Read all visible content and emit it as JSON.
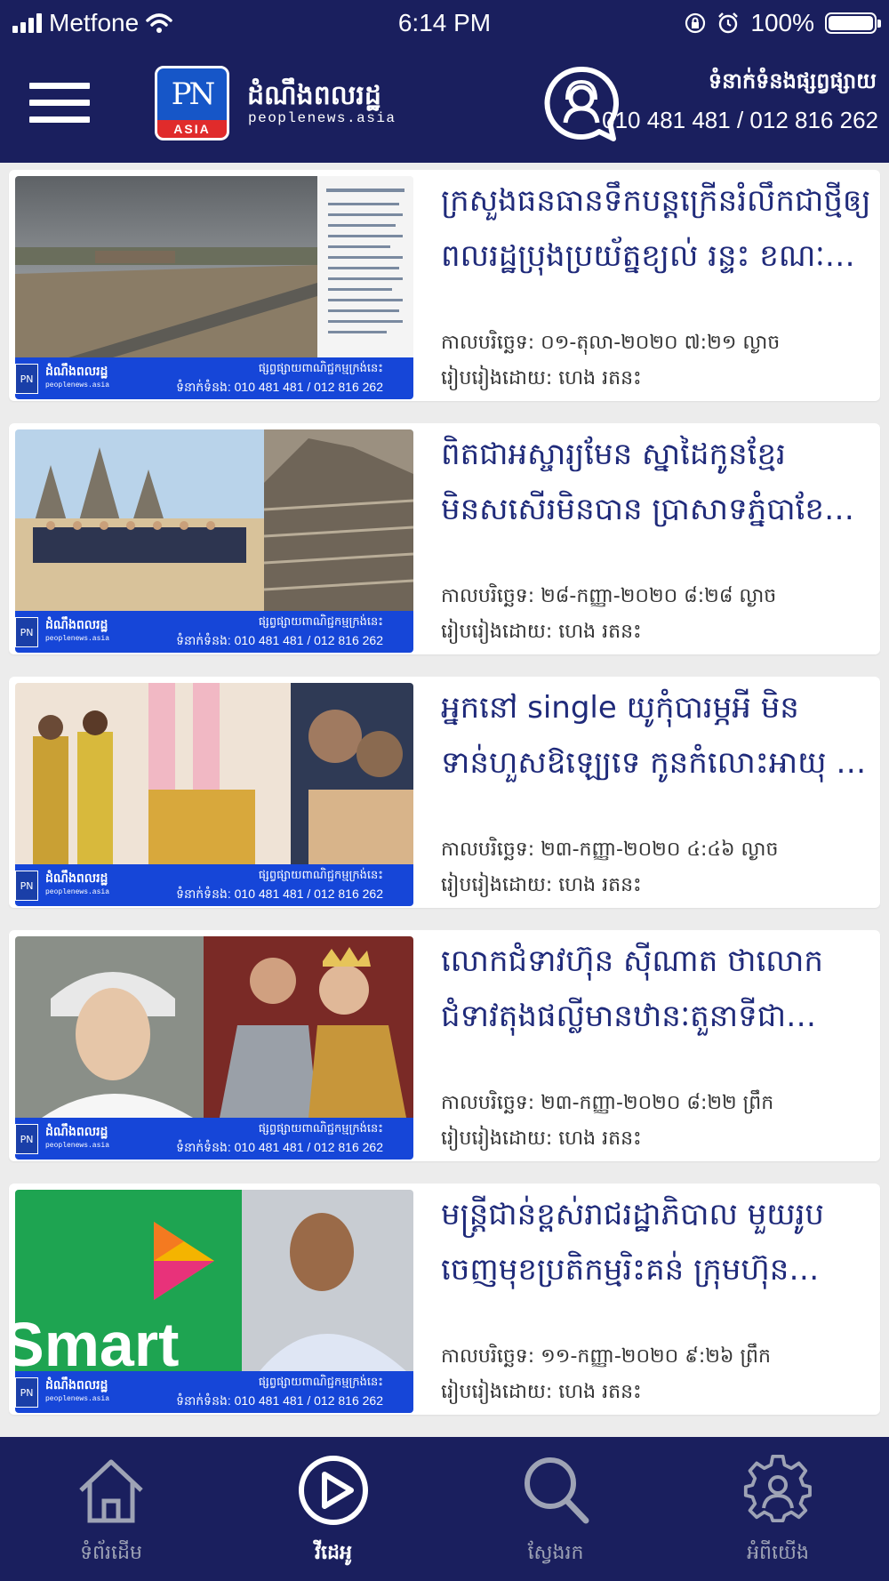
{
  "status_bar": {
    "carrier": "Metfone",
    "time": "6:14 PM",
    "battery": "100%",
    "battery_level": 1.0
  },
  "header": {
    "logo_text": "PN",
    "logo_sub": "ASIA",
    "brand_km": "ដំណឹងពលរដ្ឋ",
    "brand_en": "peoplenews.asia",
    "contact_title": "ទំនាក់ទំនងផ្សព្វផ្សាយ",
    "contact_phone": "010 481 481 / 012 816 262"
  },
  "thumb_band": {
    "brand_km": "ដំណឹងពលរដ្ឋ",
    "brand_en": "peoplenews.asia",
    "ad_line": "ផ្សព្វផ្សាយពាណិជ្ជកម្មក្រង់នេះ",
    "phone_line": "ទំនាក់ទំនង: 010 481 481  /  012 816 262"
  },
  "articles": [
    {
      "title": "ក្រសួងធនធានទឹកបន្តក្រើនរំលឹកជាថ្មីឲ្យពលរដ្ឋប្រុងប្រយ័ត្នខ្យល់ រន្ទះ ខណៈ…",
      "date": "កាលបរិច្ឆេទ: ០១-តុលា-២០២០ ៧:២១ ល្ងាច",
      "author": "រៀបរៀងដោយ: ហេង រតនះ"
    },
    {
      "title": "ពិតជាអស្ចារ្យមែន ស្នាដៃកូនខ្មែរ មិនសសើរមិនបាន ប្រាសាទភ្នំបាខែង ពី…",
      "date": "កាលបរិច្ឆេទ: ២៨-កញ្ញា-២០២០ ៨:២៨ ល្ងាច",
      "author": "រៀបរៀងដោយ: ហេង រតនះ"
    },
    {
      "title": "អ្នកនៅ single យូកុំបារម្ភអី មិនទាន់ហួសឱឡ្យេទេ កូនកំលោះអាយុ …",
      "date": "កាលបរិច្ឆេទ: ២៣-កញ្ញា-២០២០ ៤:៤៦ ល្ងាច",
      "author": "រៀបរៀងដោយ: ហេង រតនះ"
    },
    {
      "title": "លោកជំទាវហ៊ុន ស៊ីណាត ថាលោកជំទាវតុងផល្លីមានឋានៈតួនាទីជារាជកា…",
      "date": "កាលបរិច្ឆេទ: ២៣-កញ្ញា-២០២០ ៨:២២ ព្រឹក",
      "author": "រៀបរៀងដោយ: ហេង រតនះ"
    },
    {
      "title": "មន្ត្រីជាន់ខ្ពស់រាជរដ្ឋាភិបាល មួយរូបចេញមុខប្រតិកម្មរិះគន់ ក្រុមហ៊ុន Smart …",
      "date": "កាលបរិច្ឆេទ: ១១-កញ្ញា-២០២០ ៩:២៦ ព្រឹក",
      "author": "រៀបរៀងដោយ: ហេង រតនះ"
    }
  ],
  "thumb_text": {
    "smart_word": "Smart"
  },
  "bottom_nav": [
    {
      "label": "ទំព័រដើម",
      "icon": "home-icon",
      "active": false
    },
    {
      "label": "វីដេអូ",
      "icon": "play-icon",
      "active": true
    },
    {
      "label": "ស្វែងរក",
      "icon": "search-icon",
      "active": false
    },
    {
      "label": "អំពីយើង",
      "icon": "gear-user-icon",
      "active": false
    }
  ],
  "colors": {
    "header_bg": "#1a1f5e",
    "title_text": "#1f2a7a",
    "thumb_band": "#1646d8",
    "nav_inactive": "#9ea3b5"
  }
}
